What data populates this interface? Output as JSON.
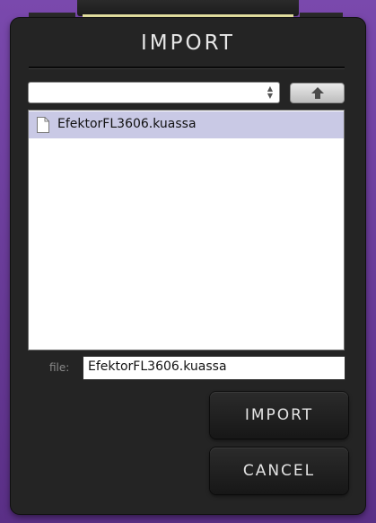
{
  "dialog": {
    "title": "IMPORT"
  },
  "path_select": {
    "value": ""
  },
  "file_list": {
    "items": [
      {
        "label": "EfektorFL3606.kuassa",
        "selected": true,
        "icon": "document-icon"
      }
    ]
  },
  "file_field": {
    "label": "file:",
    "value": "EfektorFL3606.kuassa"
  },
  "buttons": {
    "import_label": "IMPORT",
    "cancel_label": "CANCEL"
  },
  "colors": {
    "frame": "#6a3c9a",
    "dialog_bg": "#242424",
    "selection": "#c9c9e5",
    "accent_strip": "#eae6a4"
  }
}
